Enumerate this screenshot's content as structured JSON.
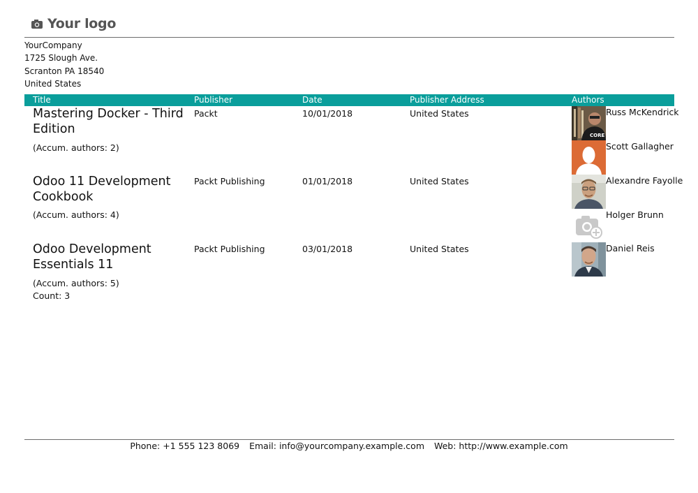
{
  "logo": {
    "text": "Your logo",
    "icon": "camera-icon"
  },
  "company": {
    "name": "YourCompany",
    "street": "1725 Slough Ave.",
    "city": "Scranton PA 18540",
    "country": "United States"
  },
  "table": {
    "columns": [
      "Title",
      "Publisher",
      "Date",
      "Publisher Address",
      "Authors"
    ],
    "accent_color": "#0a9e9b",
    "rows": [
      {
        "title": "Mastering Docker - Third Edition",
        "publisher": "Packt",
        "date": "10/01/2018",
        "address": "United States",
        "accum": "(Accum. authors: 2)",
        "authors": [
          {
            "name": "Russ McKendrick",
            "photo": "person-photo"
          },
          {
            "name": "Scott Gallagher",
            "photo": "placeholder-avatar"
          }
        ]
      },
      {
        "title": "Odoo 11 Development Cookbook",
        "publisher": "Packt Publishing",
        "date": "01/01/2018",
        "address": "United States",
        "accum": "(Accum. authors: 4)",
        "authors": [
          {
            "name": "Alexandre Fayolle",
            "photo": "person-photo"
          },
          {
            "name": "Holger Brunn",
            "photo": "camera-placeholder-icon"
          }
        ]
      },
      {
        "title": "Odoo Development Essentials 11",
        "publisher": "Packt Publishing",
        "date": "03/01/2018",
        "address": "United States",
        "accum": "(Accum. authors: 5)",
        "authors": [
          {
            "name": "Daniel Reis",
            "photo": "person-photo"
          }
        ]
      }
    ],
    "count": "Count: 3"
  },
  "footer": {
    "phone": "Phone: +1 555 123 8069",
    "email": "Email: info@yourcompany.example.com",
    "web": "Web: http://www.example.com"
  }
}
